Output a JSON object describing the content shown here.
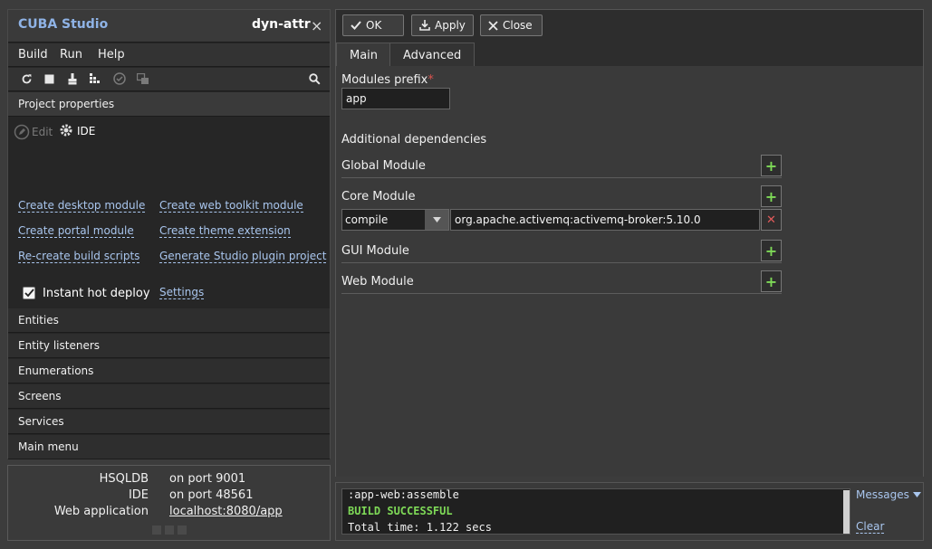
{
  "left_panel": {
    "app_title": "CUBA Studio",
    "project_name": "dyn-attr",
    "close_glyph": "×",
    "menu": [
      "Build",
      "Run",
      "Help"
    ],
    "toolbar_icons": [
      "refresh-icon",
      "stop-icon",
      "brush-icon",
      "build-blocks-icon",
      "check-circle-icon",
      "stack-icon",
      "search-icon"
    ],
    "project_properties": {
      "header": "Project properties",
      "edit_label": "Edit",
      "ide_label": "IDE",
      "links": [
        "Create desktop module",
        "Create web toolkit module",
        "Create portal module",
        "Create theme extension",
        "Re-create build scripts",
        "Generate Studio plugin project"
      ],
      "instant_hot_deploy": {
        "label": "Instant hot deploy",
        "checked": true
      },
      "settings_link": "Settings"
    },
    "sections": [
      "Entities",
      "Entity listeners",
      "Enumerations",
      "Screens",
      "Services",
      "Main menu"
    ]
  },
  "status": {
    "rows": [
      {
        "key": "HSQLDB",
        "value": "on port 9001"
      },
      {
        "key": "IDE",
        "value": "on port 48561"
      },
      {
        "key": "Web application",
        "value": "localhost:8080/app"
      }
    ]
  },
  "editor": {
    "buttons": {
      "ok": "OK",
      "apply": "Apply",
      "close": "Close"
    },
    "tabs": [
      "Main",
      "Advanced"
    ],
    "modules_prefix_label": "Modules prefix",
    "required_mark": "*",
    "modules_prefix_value": "app",
    "additional_dependencies_label": "Additional dependencies",
    "modules": {
      "global": "Global Module",
      "core": "Core Module",
      "gui": "GUI Module",
      "web": "Web Module"
    },
    "core_dependency": {
      "scope": "compile",
      "artifact": "org.apache.activemq:activemq-broker:5.10.0"
    },
    "plus_glyph": "+",
    "delete_glyph": "✕"
  },
  "console": {
    "lines": [
      ":app-web:assemble",
      "BUILD SUCCESSFUL",
      "Total time: 1.122 secs"
    ],
    "messages_label": "Messages",
    "clear_label": "Clear"
  },
  "colors": {
    "accent_link": "#a9c6ee",
    "title_blue": "#8fb3e6",
    "success_green": "#7ed957",
    "required_red": "#d9534f"
  }
}
